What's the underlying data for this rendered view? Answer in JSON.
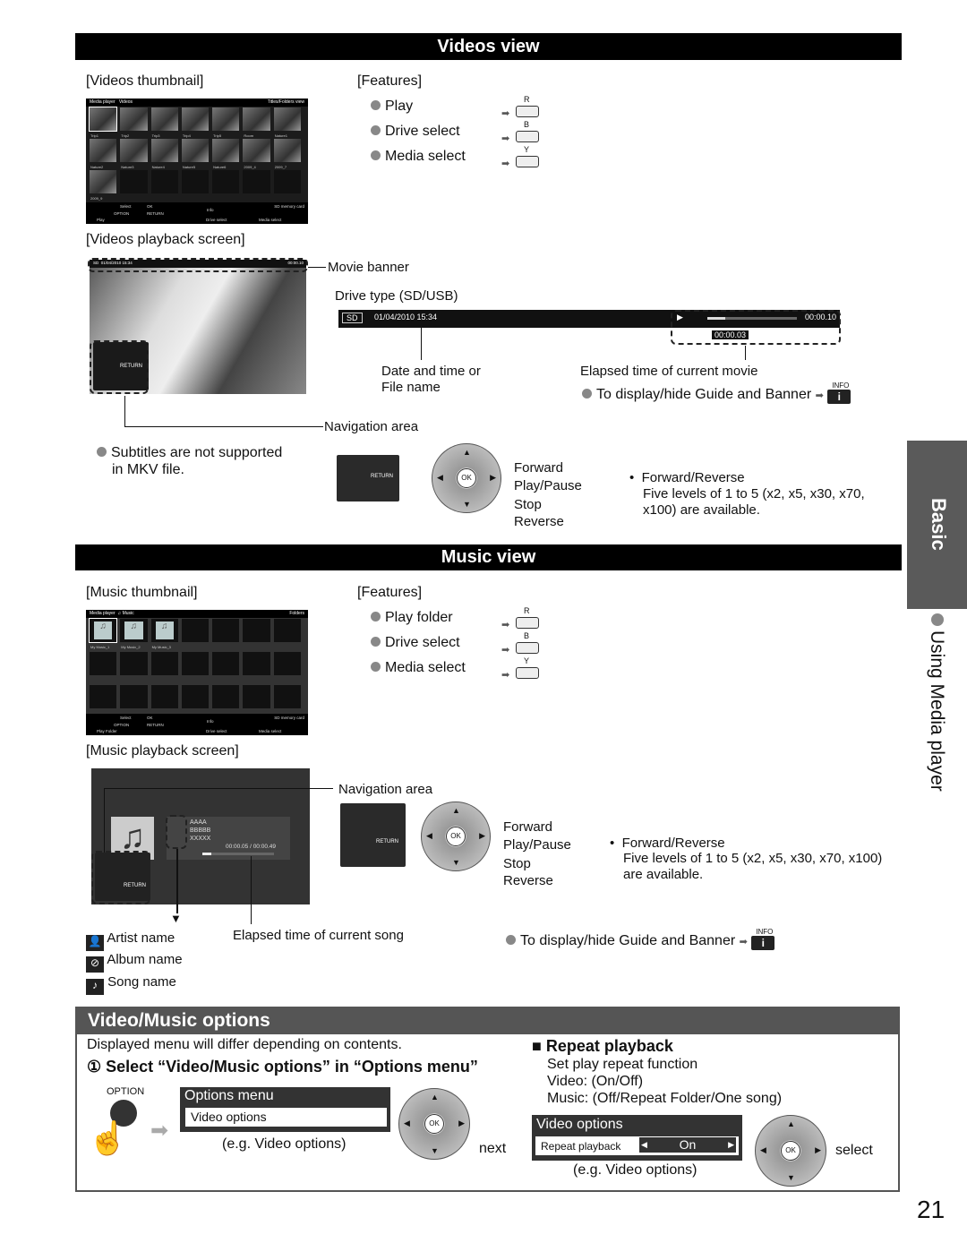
{
  "videos_view": {
    "title": "Videos view",
    "thumbnail_label": "[Videos thumbnail]",
    "thumbnail_screen": {
      "header_left": "Media player",
      "header_mid": "Videos",
      "header_right": "Titles/Folders view",
      "items": [
        "Trip1",
        "Trip2",
        "Trip3",
        "Trip4",
        "Trip5",
        "Room",
        "Nature1",
        "Nature2",
        "Nature3",
        "Nature4",
        "Nature5",
        "Nature6",
        "2009_4",
        "2009_7",
        "2009_9"
      ],
      "footer": {
        "select": "Select",
        "ok": "OK",
        "option": "OPTION",
        "return": "RETURN",
        "info": "Info",
        "storage": "SD memory card",
        "play": "Play",
        "drive_select": "Drive select",
        "media_select": "Media select"
      }
    },
    "features_label": "[Features]",
    "features": [
      {
        "label": "Play",
        "key": "R"
      },
      {
        "label": "Drive select",
        "key": "B"
      },
      {
        "label": "Media select",
        "key": "Y"
      }
    ],
    "playback_label": "[Videos playback screen]",
    "playback_screen": {
      "drive": "SD",
      "datetime": "01/04/2010  15:34",
      "time": "00:00.10",
      "elapsed": "00:00.03",
      "return": "RETURN"
    },
    "movie_banner": "Movie banner",
    "drive_type": "Drive type (SD/USB)",
    "banner": {
      "drive": "SD",
      "datetime": "01/04/2010  15:34",
      "total": "00:00.10",
      "elapsed": "00:00.03"
    },
    "date_label_1": "Date and time or",
    "date_label_2": "File name",
    "elapsed_label": "Elapsed time of current movie",
    "guide_note": "To display/hide Guide and Banner",
    "info_key": "INFO",
    "navigation_area": "Navigation area",
    "subtitles_note_1": "Subtitles are not supported",
    "subtitles_note_2": "in MKV file.",
    "nav_labels": [
      "Forward",
      "Play/Pause",
      "Stop",
      "Reverse"
    ],
    "fr_note_title": "Forward/Reverse",
    "fr_note_1": "Five levels of 1 to 5 (x2, x5, x30, x70,",
    "fr_note_2": "x100) are available."
  },
  "music_view": {
    "title": "Music view",
    "thumbnail_label": "[Music thumbnail]",
    "thumbnail_screen": {
      "header_left": "Media player",
      "header_mid": "Music",
      "header_right": "Folders",
      "items": [
        "My Music_1",
        "My Music_2",
        "My Music_3"
      ],
      "footer": {
        "select": "Select",
        "ok": "OK",
        "option": "OPTION",
        "return": "RETURN",
        "info": "Info",
        "storage": "SD memory card",
        "play": "Play Folder",
        "drive_select": "Drive select",
        "media_select": "Media select"
      }
    },
    "features_label": "[Features]",
    "features": [
      {
        "label": "Play folder",
        "key": "R"
      },
      {
        "label": "Drive select",
        "key": "B"
      },
      {
        "label": "Media select",
        "key": "Y"
      }
    ],
    "playback_label": "[Music playback screen]",
    "playback_screen": {
      "song": "AAAA",
      "album": "BBBBB",
      "artist": "XXXXX",
      "time": "00:00.05 / 00:00.49",
      "return": "RETURN"
    },
    "navigation_area": "Navigation area",
    "nav_labels": [
      "Forward",
      "Play/Pause",
      "Stop",
      "Reverse"
    ],
    "fr_note_title": "Forward/Reverse",
    "fr_note_1": "Five levels of 1 to 5 (x2, x5, x30, x70, x100)",
    "fr_note_2": "are available.",
    "legend": [
      "Artist name",
      "Album name",
      "Song name"
    ],
    "elapsed_label": "Elapsed time of current song",
    "guide_note": "To display/hide Guide and Banner",
    "info_key": "INFO"
  },
  "options": {
    "title": "Video/Music options",
    "intro": "Displayed menu will differ depending on contents.",
    "step1": "① Select “Video/Music options” in “Options menu”",
    "option_key": "OPTION",
    "menu_title": "Options menu",
    "menu_item": "Video options",
    "eg": "(e.g. Video options)",
    "next": "next",
    "ok": "OK",
    "repeat_title": "Repeat playback",
    "repeat_desc": "Set play repeat function",
    "repeat_video": "Video: (On/Off)",
    "repeat_music": "Music: (Off/Repeat Folder/One song)",
    "vo_title": "Video options",
    "vo_item": "Repeat playback",
    "vo_value": "On",
    "eg2": "(e.g. Video options)",
    "select": "select"
  },
  "side_tab": {
    "section": "Basic",
    "topic": "Using Media player"
  },
  "page_number": "21"
}
